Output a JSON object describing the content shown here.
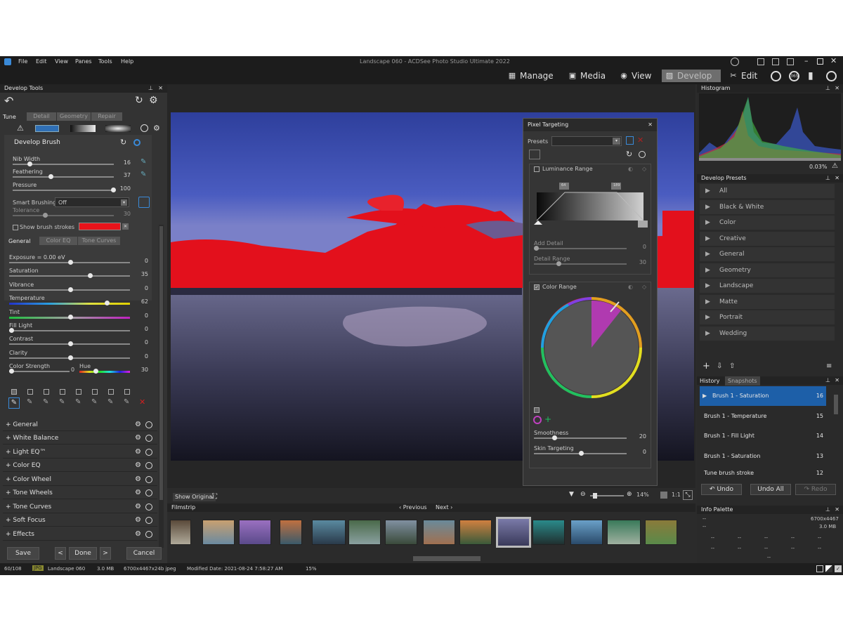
{
  "app": {
    "title": "Landscape 060 - ACDSee Photo Studio Ultimate 2022",
    "menu": [
      "File",
      "Edit",
      "View",
      "Panes",
      "Tools",
      "Help"
    ],
    "modes": [
      {
        "label": "Manage",
        "icon": "grid-icon"
      },
      {
        "label": "Media",
        "icon": "media-icon"
      },
      {
        "label": "View",
        "icon": "eye-icon"
      },
      {
        "label": "Develop",
        "icon": "develop-icon"
      },
      {
        "label": "Edit",
        "icon": "scissors-icon"
      }
    ]
  },
  "develop_tools": {
    "title": "Develop Tools",
    "tabs": [
      "Tune",
      "Detail",
      "Geometry",
      "Repair"
    ],
    "brush": {
      "title": "Develop Brush",
      "sliders": [
        {
          "label": "Nib Width",
          "value": "16",
          "pos": 0.15
        },
        {
          "label": "Feathering",
          "value": "37",
          "pos": 0.37
        },
        {
          "label": "Pressure",
          "value": "100",
          "pos": 1.0
        }
      ],
      "smart_brushing_label": "Smart Brushing:",
      "smart_brushing_value": "Off",
      "tolerance_label": "Tolerance",
      "tolerance_value": "30",
      "show_strokes_label": "Show brush strokes",
      "stroke_color": "#e8131a"
    },
    "subtabs": [
      "General",
      "Color EQ",
      "Tone Curves"
    ],
    "adjustments": [
      {
        "label": "Exposure = 0.00 eV",
        "value": "0",
        "pos": 0.5
      },
      {
        "label": "Saturation",
        "value": "35",
        "pos": 0.67
      },
      {
        "label": "Vibrance",
        "value": "0",
        "pos": 0.5
      },
      {
        "label": "Temperature",
        "value": "62",
        "pos": 0.81
      },
      {
        "label": "Tint",
        "value": "0",
        "pos": 0.5
      },
      {
        "label": "Fill Light",
        "value": "0",
        "pos": 0.0
      },
      {
        "label": "Contrast",
        "value": "0",
        "pos": 0.5
      },
      {
        "label": "Clarity",
        "value": "0",
        "pos": 0.5
      }
    ],
    "color_strength": {
      "label": "Color Strength",
      "value": "0",
      "hue_label": "Hue",
      "hue_value": "30"
    },
    "groups": [
      "General",
      "White Balance",
      "Light EQ™",
      "Color EQ",
      "Color Wheel",
      "Tone Wheels",
      "Tone Curves",
      "Soft Focus",
      "Effects"
    ],
    "buttons": {
      "save": "Save",
      "done": "Done",
      "cancel": "Cancel",
      "prev": "<",
      "next": ">"
    }
  },
  "pixel_targeting": {
    "title": "Pixel Targeting",
    "presets_label": "Presets",
    "luminance_label": "Luminance Range",
    "lum_markers": [
      "64",
      "189"
    ],
    "add_detail": {
      "label": "Add Detail",
      "value": "0"
    },
    "detail_range": {
      "label": "Detail Range",
      "value": "30"
    },
    "color_range_label": "Color Range",
    "smoothness": {
      "label": "Smoothness",
      "value": "20"
    },
    "skin_targeting": {
      "label": "Skin Targeting",
      "value": "0"
    }
  },
  "image_bar": {
    "show_original": "Show Original",
    "zoom": "14%",
    "ratio": "1:1"
  },
  "filmstrip": {
    "title": "Filmstrip",
    "previous": "Previous",
    "next": "Next",
    "thumbs": [
      [
        "#5a4a3a",
        "#b0aa9a"
      ],
      [
        "#c8a070",
        "#6a8aa0"
      ],
      [
        "#9a70c0",
        "#5a4a8a"
      ],
      [
        "#c07040",
        "#3a5a6a"
      ],
      [
        "#5a8aa0",
        "#2a3a4a"
      ],
      [
        "#4a6a4a",
        "#8aa0a0"
      ],
      [
        "#8090a0",
        "#3a4a3a"
      ],
      [
        "#6a8a9a",
        "#a07050"
      ],
      [
        "#d08040",
        "#3a5a3a"
      ],
      [
        "#7a7aa8",
        "#3a3a5a"
      ],
      [
        "#2a8a8a",
        "#203030"
      ],
      [
        "#6aa0c8",
        "#2a4a6a"
      ],
      [
        "#3a7a5a",
        "#a0b0a0"
      ],
      [
        "#8a7a3a",
        "#5a8a4a"
      ]
    ]
  },
  "histogram": {
    "title": "Histogram",
    "value": "0.03%"
  },
  "develop_presets": {
    "title": "Develop Presets",
    "items": [
      "All",
      "Black & White",
      "Color",
      "Creative",
      "General",
      "Geometry",
      "Landscape",
      "Matte",
      "Portrait",
      "Wedding"
    ]
  },
  "history": {
    "tabs": [
      "History",
      "Snapshots"
    ],
    "items": [
      {
        "label": "Brush 1 - Saturation",
        "num": "16"
      },
      {
        "label": "Brush 1 - Temperature",
        "num": "15"
      },
      {
        "label": "Brush 1 - Fill Light",
        "num": "14"
      },
      {
        "label": "Brush 1 - Saturation",
        "num": "13"
      },
      {
        "label": "Tune brush stroke",
        "num": "12"
      }
    ],
    "undo": "Undo",
    "undo_all": "Undo All",
    "redo": "Redo"
  },
  "info_palette": {
    "title": "Info Palette",
    "dims": "6700x4467",
    "size": "3.0 MB",
    "dash": "--"
  },
  "status": {
    "count": "60/108",
    "type": "JPG",
    "name": "Landscape 060",
    "size": "3.0 MB",
    "dims": "6700x4467x24b jpeg",
    "modified": "Modified Date: 2021-08-24 7:58:27 AM",
    "zoom": "15%"
  }
}
